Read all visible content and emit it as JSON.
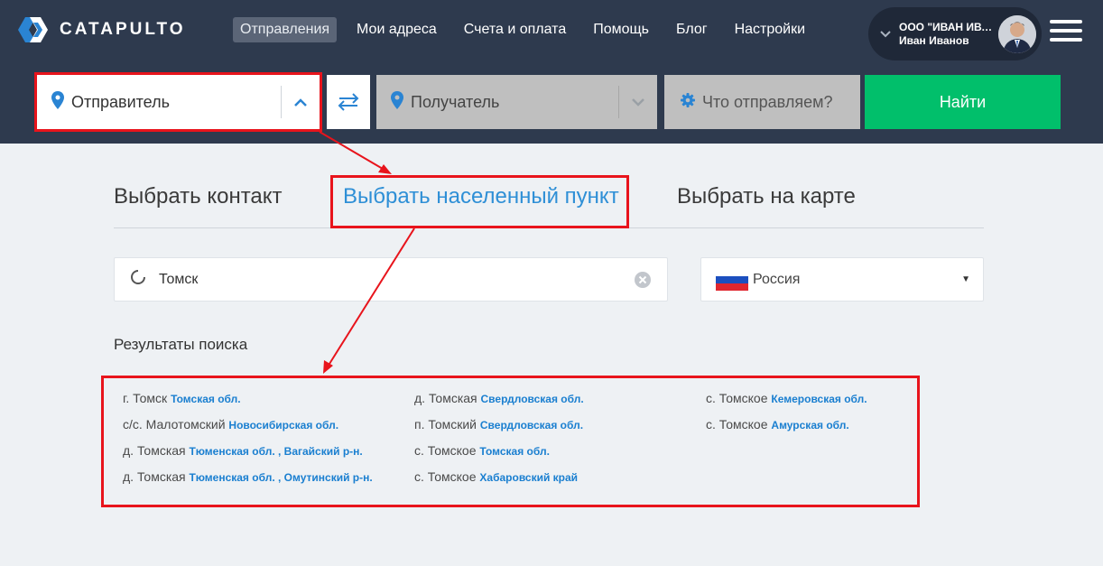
{
  "brand": {
    "name": "CATAPULTO"
  },
  "nav": [
    {
      "label": "Отправления",
      "active": true
    },
    {
      "label": "Мои адреса"
    },
    {
      "label": "Счета и оплата"
    },
    {
      "label": "Помощь"
    },
    {
      "label": "Блог"
    },
    {
      "label": "Настройки"
    }
  ],
  "account": {
    "company": "ООО \"ИВАН ИВАН...",
    "user": "Иван Иванов"
  },
  "search": {
    "sender": "Отправитель",
    "recipient": "Получатель",
    "what": "Что отправляем?",
    "find_button": "Найти"
  },
  "tabs": [
    {
      "label": "Выбрать контакт"
    },
    {
      "label": "Выбрать населенный пункт",
      "active": true
    },
    {
      "label": "Выбрать на карте"
    }
  ],
  "city_input": {
    "value": "Томск"
  },
  "country": {
    "selected": "Россия"
  },
  "results_title": "Результаты поиска",
  "results": [
    {
      "name": "г. Томск",
      "region": "Томская обл."
    },
    {
      "name": "с/с. Малотомский",
      "region": "Новосибирская обл."
    },
    {
      "name": "д. Томская",
      "region": "Тюменская обл. , Вагайский р-н."
    },
    {
      "name": "д. Томская",
      "region": "Тюменская обл. , Омутинский р-н."
    },
    {
      "name": "д. Томская",
      "region": "Свердловская обл."
    },
    {
      "name": "п. Томский",
      "region": "Свердловская обл."
    },
    {
      "name": "с. Томское",
      "region": "Томская обл."
    },
    {
      "name": "с. Томское",
      "region": "Хабаровский край"
    },
    {
      "name": "с. Томское",
      "region": "Кемеровская обл."
    },
    {
      "name": "с. Томское",
      "region": "Амурская обл."
    }
  ],
  "colors": {
    "header_bg": "#2e3a4e",
    "accent_blue": "#2e8fd6",
    "find_green": "#01bf6b",
    "annotation_red": "#e8141c",
    "page_bg": "#eef1f4"
  }
}
